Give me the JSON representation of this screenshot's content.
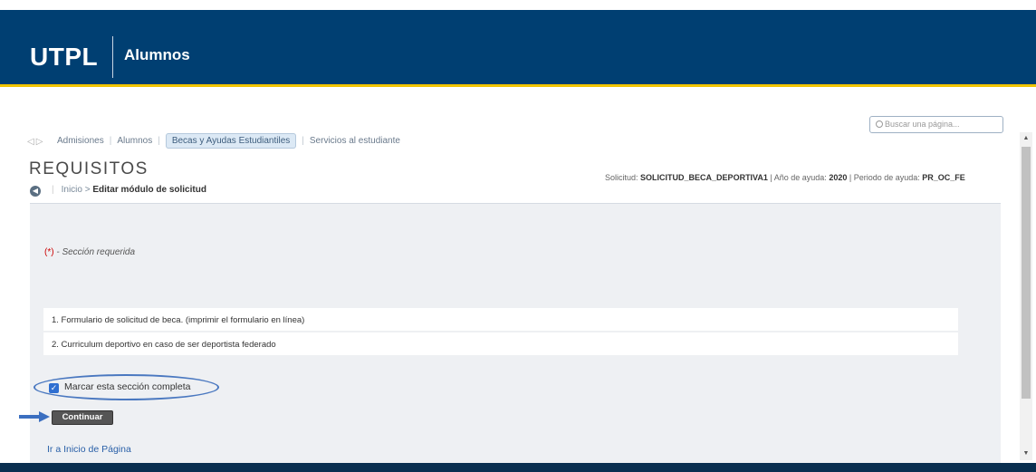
{
  "header": {
    "logo": "UTPL",
    "app_title": "Alumnos"
  },
  "search": {
    "placeholder": "Buscar una página..."
  },
  "tabs": [
    {
      "label": "Admisiones"
    },
    {
      "label": "Alumnos"
    },
    {
      "label": "Becas y Ayudas Estudiantiles",
      "active": true
    },
    {
      "label": "Servicios al estudiante"
    }
  ],
  "page": {
    "title": "REQUISITOS",
    "crumb_home": "Inicio",
    "crumb_separator": ">",
    "crumb_current": "Editar módulo de solicitud"
  },
  "solicitud": {
    "solicitud_label": "Solicitud:",
    "solicitud_value": "SOLICITUD_BECA_DEPORTIVA1",
    "anio_label": "Año de ayuda:",
    "anio_value": "2020",
    "periodo_label": "Periodo de ayuda:",
    "periodo_value": "PR_OC_FE"
  },
  "required_note": {
    "asterisk": "(*)",
    "text": " - Sección requerida"
  },
  "requirements": [
    "1. Formulario de solicitud de beca. (imprimir el formulario en línea)",
    "2. Curriculum deportivo en caso de ser deportista federado"
  ],
  "complete_checkbox": {
    "label": "Marcar esta sección completa",
    "checked": true
  },
  "continue_button": "Continuar",
  "top_link": "Ir a Inicio de Página",
  "colors": {
    "header": "#003f72",
    "stripe": "#f1c400",
    "highlight": "#3b6fc0"
  }
}
